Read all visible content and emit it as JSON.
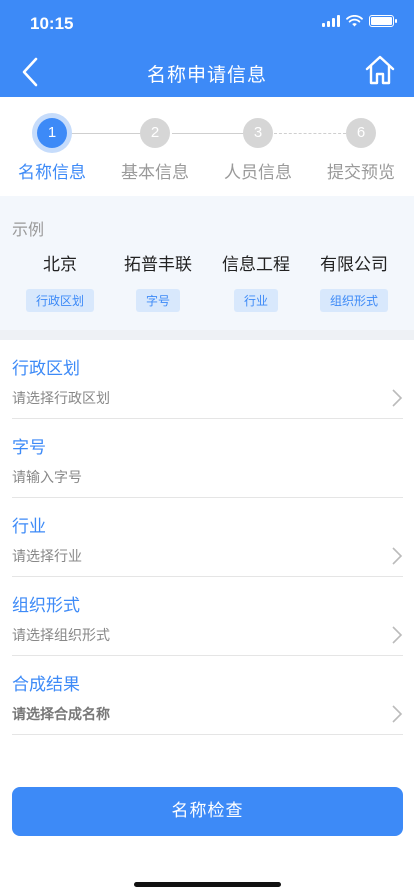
{
  "status_bar": {
    "time": "10:15"
  },
  "nav": {
    "title": "名称申请信息"
  },
  "steps": [
    {
      "number": "1",
      "label": "名称信息",
      "active": true
    },
    {
      "number": "2",
      "label": "基本信息",
      "active": false
    },
    {
      "number": "3",
      "label": "人员信息",
      "active": false
    },
    {
      "number": "6",
      "label": "提交预览",
      "active": false
    }
  ],
  "example": {
    "title": "示例",
    "items": [
      {
        "word": "北京",
        "tag": "行政区划"
      },
      {
        "word": "拓普丰联",
        "tag": "字号"
      },
      {
        "word": "信息工程",
        "tag": "行业"
      },
      {
        "word": "有限公司",
        "tag": "组织形式"
      }
    ]
  },
  "form": {
    "fields": [
      {
        "label": "行政区划",
        "placeholder": "请选择行政区划",
        "has_chevron": true
      },
      {
        "label": "字号",
        "placeholder": "请输入字号",
        "has_chevron": false
      },
      {
        "label": "行业",
        "placeholder": "请选择行业",
        "has_chevron": true
      },
      {
        "label": "组织形式",
        "placeholder": "请选择组织形式",
        "has_chevron": true
      },
      {
        "label": "合成结果",
        "placeholder": "请选择合成名称",
        "has_chevron": true
      }
    ]
  },
  "actions": {
    "check_label": "名称检查"
  },
  "colors": {
    "primary": "#3d8af7",
    "tag_bg": "#d8e8fc",
    "inactive_step": "#d6d6d6"
  },
  "icons": [
    "back-arrow-icon",
    "home-icon",
    "cellular-signal-icon",
    "wifi-icon",
    "battery-icon",
    "chevron-right-icon"
  ]
}
